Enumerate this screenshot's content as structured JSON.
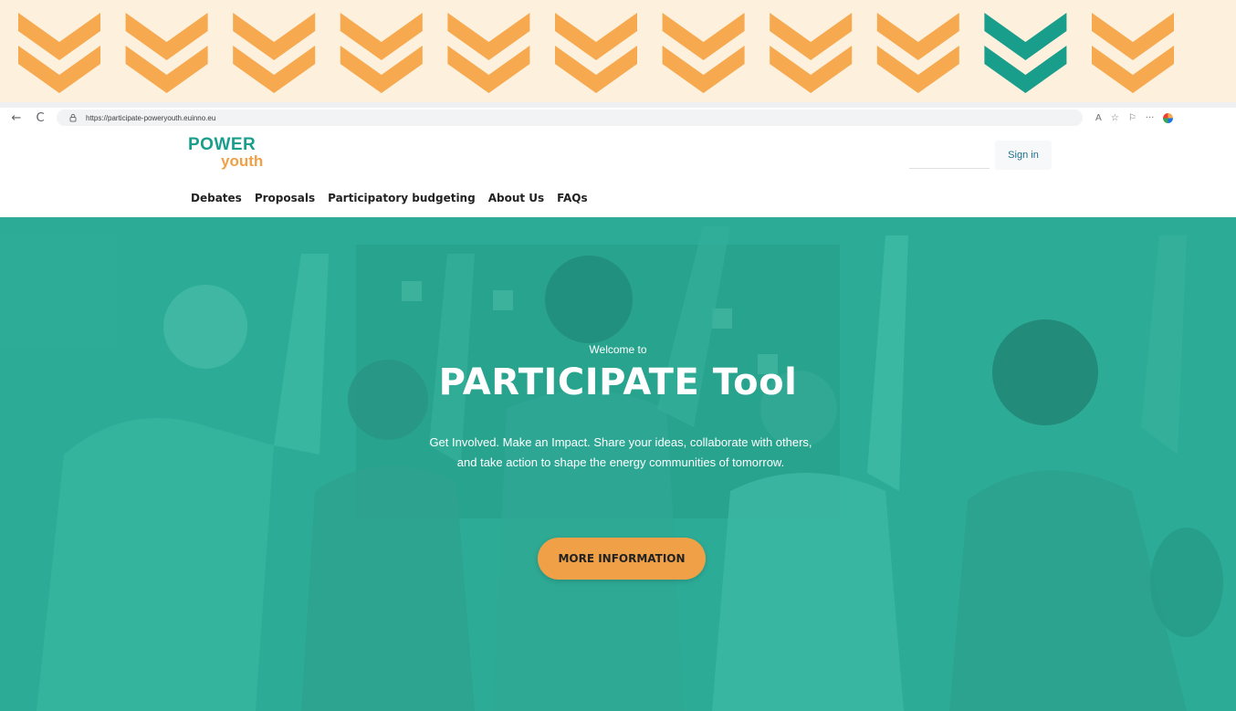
{
  "browser": {
    "url": "https://participate-poweryouth.euinno.eu",
    "back_glyph": "←",
    "reload_glyph": "C",
    "lock_icon": "lock-icon",
    "read_aloud_glyph": "A",
    "favorites_glyph": "☆",
    "collections_glyph": "⚐",
    "more_glyph": "···"
  },
  "site": {
    "logo_power": "POWER",
    "logo_youth": "youth",
    "sign_in_label": "Sign in",
    "nav": [
      "Debates",
      "Proposals",
      "Participatory budgeting",
      "About Us",
      "FAQs"
    ]
  },
  "hero": {
    "eyebrow": "Welcome to",
    "title": "PARTICIPATE Tool",
    "description": "Get Involved. Make an Impact. Share your ideas, collaborate with others, and take action to shape the energy communities of tomorrow.",
    "cta_label": "MORE INFORMATION"
  },
  "colors": {
    "banner_bg": "#fdf0dc",
    "chevron_orange": "#f6a94f",
    "chevron_teal": "#1a9e8c",
    "brand_teal": "#1a9e8c",
    "brand_orange": "#f0a046",
    "hero_teal": "#2aa892"
  }
}
